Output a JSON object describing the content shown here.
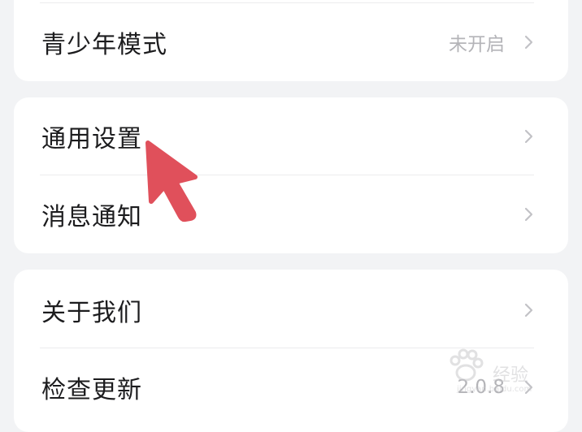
{
  "card1": {
    "items": [
      {
        "label": "青少年模式",
        "value": "未开启",
        "icon": "chevron-right-icon"
      }
    ]
  },
  "card2": {
    "items": [
      {
        "label": "通用设置",
        "icon": "chevron-right-icon"
      },
      {
        "label": "消息通知",
        "icon": "chevron-right-icon"
      }
    ]
  },
  "card3": {
    "items": [
      {
        "label": "关于我们",
        "icon": "chevron-right-icon"
      },
      {
        "label": "检查更新",
        "value": "2.0.8",
        "icon": "chevron-right-icon"
      }
    ]
  },
  "annotation": {
    "pointer_icon": "arrow-pointer-icon",
    "color": "#e0505b"
  },
  "watermark": {
    "text": "经验",
    "url": "jingyan.baidu.com",
    "icon": "paw-logo-icon"
  }
}
